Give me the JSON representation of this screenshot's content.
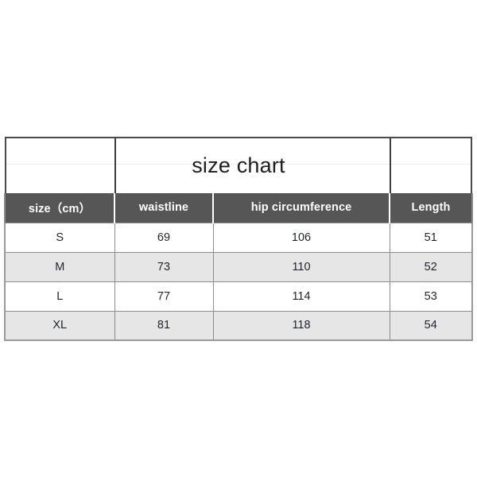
{
  "chart_data": {
    "type": "table",
    "title": "size chart",
    "columns": [
      "size（cm）",
      "waistline",
      "hip circumference",
      "Length"
    ],
    "rows": [
      {
        "size": "S",
        "waistline": "69",
        "hip": "106",
        "length": "51"
      },
      {
        "size": "M",
        "waistline": "73",
        "hip": "110",
        "length": "52"
      },
      {
        "size": "L",
        "waistline": "77",
        "hip": "114",
        "length": "53"
      },
      {
        "size": "XL",
        "waistline": "81",
        "hip": "118",
        "length": "54"
      }
    ],
    "xlabel": "",
    "ylabel": "",
    "legend": "none",
    "grid": true
  },
  "table": {
    "title": "size chart",
    "headers": {
      "size": "size（cm）",
      "waistline": "waistline",
      "hip": "hip circumference",
      "length": "Length"
    },
    "rows": [
      {
        "size": "S",
        "waistline": "69",
        "hip": "106",
        "length": "51"
      },
      {
        "size": "M",
        "waistline": "73",
        "hip": "110",
        "length": "52"
      },
      {
        "size": "L",
        "waistline": "77",
        "hip": "114",
        "length": "53"
      },
      {
        "size": "XL",
        "waistline": "81",
        "hip": "118",
        "length": "54"
      }
    ]
  },
  "colors": {
    "page_background": "#ffffff",
    "header_background": "#565656",
    "header_text": "#ffffff",
    "row_alt_background": "#e6e6e6",
    "row_background": "#ffffff",
    "border": "#8c8c8c",
    "outer_border": "#4a4a4a",
    "title_text": "#1c1c22",
    "body_text": "#1f2430"
  }
}
